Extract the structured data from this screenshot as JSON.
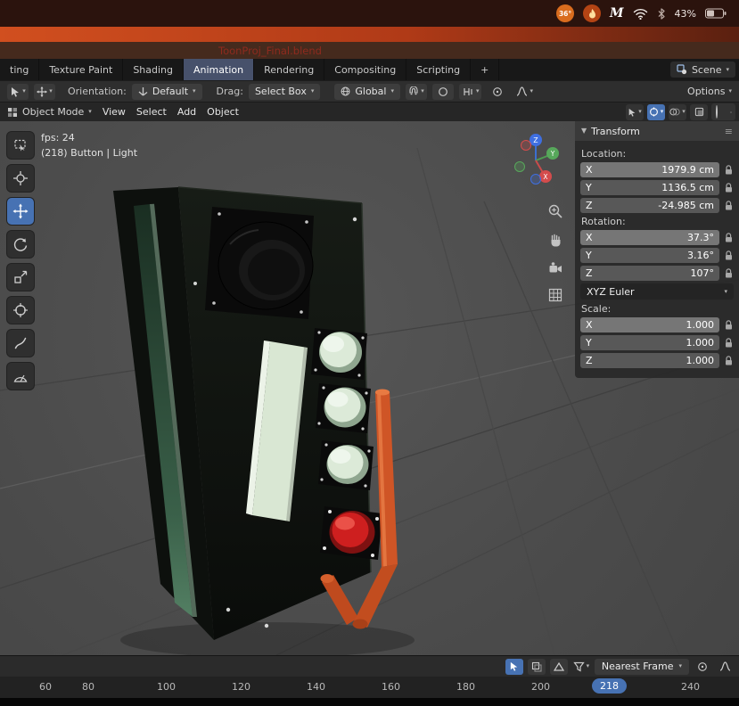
{
  "menubar": {
    "temp": "36°",
    "m_label": "M",
    "battery": "43%"
  },
  "window_title": "ToonProj_Final.blend",
  "tabs": {
    "items": [
      "ting",
      "Texture Paint",
      "Shading",
      "Animation",
      "Rendering",
      "Compositing",
      "Scripting",
      "+"
    ],
    "scene": "Scene"
  },
  "tool_settings": {
    "orientation_label": "Orientation:",
    "orientation": "Default",
    "drag_label": "Drag:",
    "drag": "Select Box",
    "pivot": "Global",
    "options": "Options"
  },
  "header": {
    "mode": "Object Mode",
    "menus": [
      "View",
      "Select",
      "Add",
      "Object"
    ]
  },
  "viewport": {
    "fps": "fps: 24",
    "status": "(218) Button | Light"
  },
  "panel": {
    "title": "Transform",
    "location_label": "Location:",
    "loc": [
      {
        "a": "X",
        "v": "1979.9 cm"
      },
      {
        "a": "Y",
        "v": "1136.5 cm"
      },
      {
        "a": "Z",
        "v": "-24.985 cm"
      }
    ],
    "rotation_label": "Rotation:",
    "rot": [
      {
        "a": "X",
        "v": "37.3°"
      },
      {
        "a": "Y",
        "v": "3.16°"
      },
      {
        "a": "Z",
        "v": "107°"
      }
    ],
    "euler": "XYZ Euler",
    "scale_label": "Scale:",
    "scl": [
      {
        "a": "X",
        "v": "1.000"
      },
      {
        "a": "Y",
        "v": "1.000"
      },
      {
        "a": "Z",
        "v": "1.000"
      }
    ]
  },
  "timeline": {
    "frame_mode": "Nearest Frame",
    "current": "218",
    "ticks": [
      "60",
      "80",
      "100",
      "120",
      "140",
      "160",
      "180",
      "200",
      "240"
    ]
  },
  "colors": {
    "accent": "#4772b3",
    "orange": "#cf5526",
    "mint": "#d9e7d3",
    "red": "#ce1f1f"
  }
}
